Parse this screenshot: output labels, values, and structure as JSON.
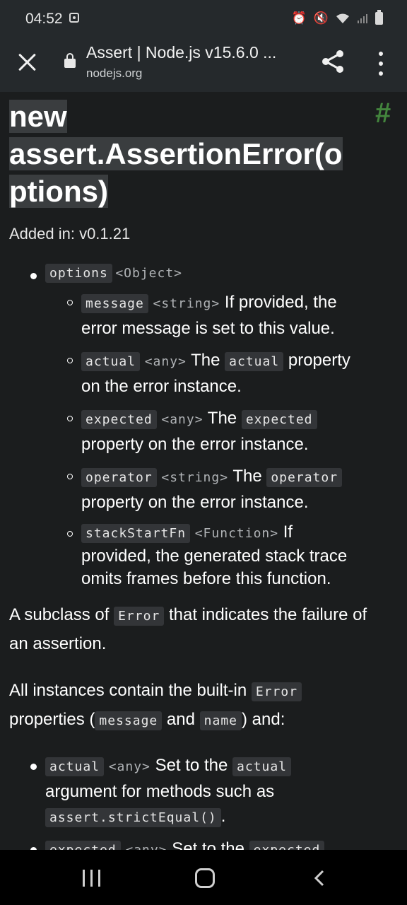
{
  "status_bar": {
    "time": "04:52"
  },
  "toolbar": {
    "title": "Assert | Node.js v15.6.0 ...",
    "url": "nodejs.org"
  },
  "heading": {
    "line1": "new",
    "line2": "assert.AssertionError(o",
    "line3": "ptions)",
    "anchor": "#"
  },
  "added_in": "Added in: v0.1.21",
  "options": {
    "name": "options",
    "type": "<Object>",
    "items": [
      {
        "name": "message",
        "type": "<string>",
        "desc_a": "If provided, the",
        "desc_b": "error message is set to this value."
      },
      {
        "name": "actual",
        "type": "<any>",
        "pre": "The",
        "code": "actual",
        "post": "property",
        "desc_b": "on the error instance."
      },
      {
        "name": "expected",
        "type": "<any>",
        "pre": "The",
        "code": "expected",
        "desc_b": "property on the error instance."
      },
      {
        "name": "operator",
        "type": "<string>",
        "pre": "The",
        "code": "operator",
        "desc_b": "property on the error instance."
      },
      {
        "name": "stackStartFn",
        "type": "<Function>",
        "desc_a": "If",
        "desc_b": "provided, the generated stack trace",
        "desc_c": "omits frames before this function."
      }
    ]
  },
  "para1": {
    "a": "A subclass of",
    "code": "Error",
    "b": "that indicates the failure of",
    "c": "an assertion."
  },
  "para2": {
    "a": "All instances contain the built-in",
    "code1": "Error",
    "b": "properties (",
    "code2": "message",
    "c": "and",
    "code3": "name",
    "d": ") and:"
  },
  "bottom_list": [
    {
      "name": "actual",
      "type": "<any>",
      "a": "Set to the",
      "code": "actual",
      "b": "argument for methods such as",
      "code2": "assert.strictEqual()",
      "c": "."
    },
    {
      "name": "expected",
      "type": "<any>",
      "a": "Set to the",
      "code": "expected"
    }
  ]
}
